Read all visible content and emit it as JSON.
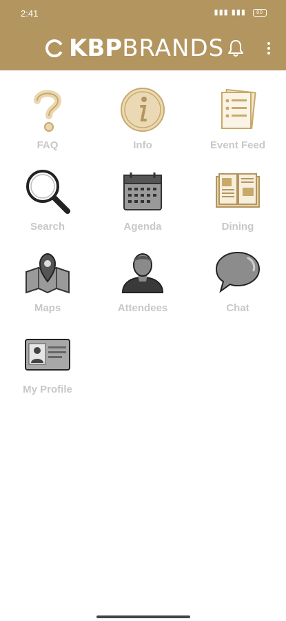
{
  "status": {
    "time": "2:41",
    "battery": "80"
  },
  "brand": {
    "part1": "KBP",
    "part2": "BRANDS"
  },
  "colors": {
    "header": "#b39560",
    "label": "#c8c8c8",
    "gold": "#c9a96a"
  },
  "tiles": [
    {
      "label": "FAQ",
      "icon": "question-icon"
    },
    {
      "label": "Info",
      "icon": "info-icon"
    },
    {
      "label": "Event Feed",
      "icon": "event-feed-icon"
    },
    {
      "label": "Search",
      "icon": "magnifier-icon"
    },
    {
      "label": "Agenda",
      "icon": "calendar-icon"
    },
    {
      "label": "Dining",
      "icon": "menu-book-icon"
    },
    {
      "label": "Maps",
      "icon": "map-pin-icon"
    },
    {
      "label": "Attendees",
      "icon": "person-icon"
    },
    {
      "label": "Chat",
      "icon": "chat-bubble-icon"
    },
    {
      "label": "My Profile",
      "icon": "id-card-icon"
    }
  ]
}
